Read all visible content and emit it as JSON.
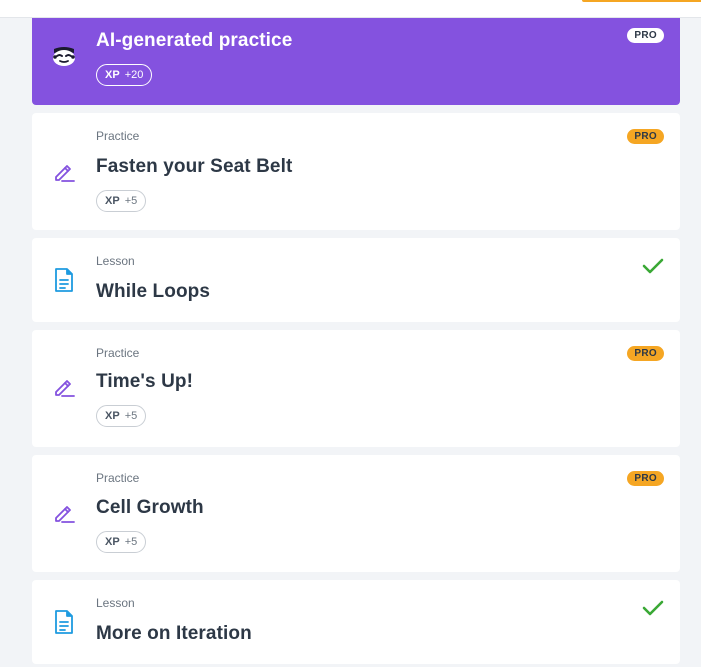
{
  "colors": {
    "ai_card": "#8452df",
    "pro_badge": "#f5a623",
    "practice_icon": "#8452df",
    "lesson_icon": "#1e9be0",
    "check": "#3aa835"
  },
  "ai_practice": {
    "title": "AI-generated practice",
    "xp_label": "XP",
    "xp_value": "+20",
    "badge": "PRO",
    "icon": "ai-mascot-icon"
  },
  "items": [
    {
      "kind": "Practice",
      "title": "Fasten your Seat Belt",
      "xp_label": "XP",
      "xp_value": "+5",
      "badge": "PRO",
      "icon": "pencil-icon"
    },
    {
      "kind": "Lesson",
      "title": "While Loops",
      "status": "completed",
      "icon": "document-icon"
    },
    {
      "kind": "Practice",
      "title": "Time's Up!",
      "xp_label": "XP",
      "xp_value": "+5",
      "badge": "PRO",
      "icon": "pencil-icon"
    },
    {
      "kind": "Practice",
      "title": "Cell Growth",
      "xp_label": "XP",
      "xp_value": "+5",
      "badge": "PRO",
      "icon": "pencil-icon"
    },
    {
      "kind": "Lesson",
      "title": "More on Iteration",
      "status": "completed",
      "icon": "document-icon"
    }
  ]
}
